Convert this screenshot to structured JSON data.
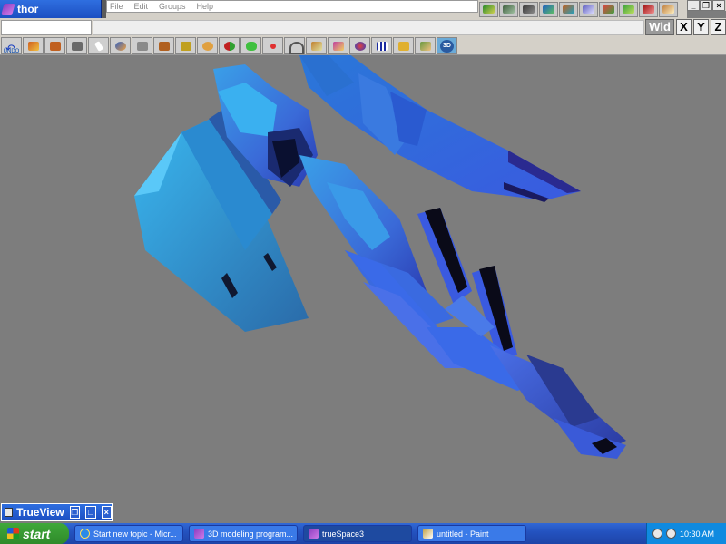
{
  "window": {
    "title": "thor",
    "menu": [
      "File",
      "Edit",
      "Groups",
      "Help"
    ],
    "controls": {
      "minimize": "_",
      "restore": "❐",
      "close": "×"
    }
  },
  "axis_buttons": {
    "world": "Wld",
    "x": "X",
    "y": "Y",
    "z": "Z"
  },
  "toolbar": {
    "undo_label": "UNDO",
    "threeD_label": "3D"
  },
  "trueview": {
    "title": "TrueView",
    "controls": {
      "restore": "❐",
      "maximize": "□",
      "close": "×"
    }
  },
  "taskbar": {
    "start_label": "start",
    "tasks": [
      {
        "label": "Start new topic - Micr...",
        "icon": "internet-explorer-icon",
        "active": false
      },
      {
        "label": "3D modeling program...",
        "icon": "truespace-icon",
        "active": false
      },
      {
        "label": "trueSpace3",
        "icon": "truespace-icon",
        "active": true
      },
      {
        "label": "untitled - Paint",
        "icon": "paint-icon",
        "active": false
      }
    ],
    "clock": "10:30 AM"
  },
  "colors": {
    "viewport_bg": "#7d7d7d",
    "model_light": "#3aaae8",
    "model_dark": "#2a3aa8",
    "titlebar": "#2459d0"
  }
}
